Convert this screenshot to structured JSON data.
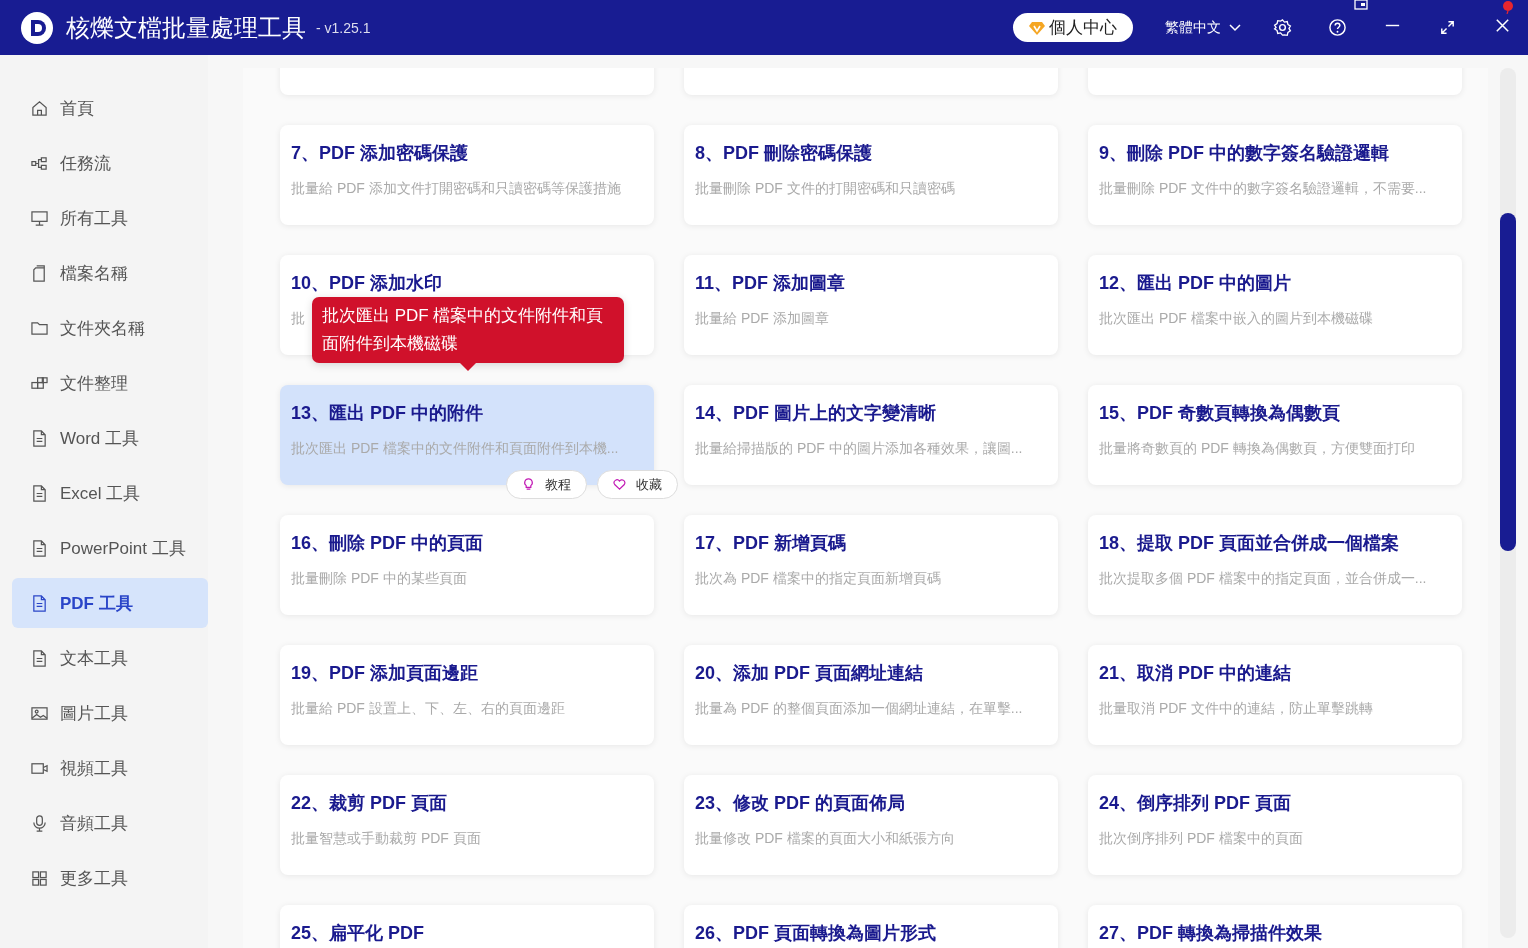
{
  "app": {
    "title": "核爍文檔批量處理工具",
    "version": "- v1.25.1",
    "user_center": "個人中心",
    "language": "繁體中文"
  },
  "sidebar": {
    "items": [
      {
        "label": "首頁",
        "selected": false
      },
      {
        "label": "任務流",
        "selected": false
      },
      {
        "label": "所有工具",
        "selected": false
      },
      {
        "label": "檔案名稱",
        "selected": false
      },
      {
        "label": "文件夾名稱",
        "selected": false
      },
      {
        "label": "文件整理",
        "selected": false
      },
      {
        "label": "Word 工具",
        "selected": false
      },
      {
        "label": "Excel 工具",
        "selected": false
      },
      {
        "label": "PowerPoint 工具",
        "selected": false
      },
      {
        "label": "PDF 工具",
        "selected": true
      },
      {
        "label": "文本工具",
        "selected": false
      },
      {
        "label": "圖片工具",
        "selected": false
      },
      {
        "label": "視頻工具",
        "selected": false
      },
      {
        "label": "音頻工具",
        "selected": false
      },
      {
        "label": "更多工具",
        "selected": false
      }
    ]
  },
  "cards": [
    {
      "title": "7、PDF 添加密碼保護",
      "description": "批量給 PDF 添加文件打開密碼和只讀密碼等保護措施",
      "hovered": false
    },
    {
      "title": "8、PDF 刪除密碼保護",
      "description": "批量刪除 PDF 文件的打開密碼和只讀密碼",
      "hovered": false
    },
    {
      "title": "9、刪除 PDF 中的數字簽名驗證邏輯",
      "description": "批量刪除 PDF 文件中的數字簽名驗證邏輯，不需要...",
      "hovered": false
    },
    {
      "title": "10、PDF 添加水印",
      "description": "批",
      "hovered": false
    },
    {
      "title": "11、PDF 添加圖章",
      "description": "批量給 PDF 添加圖章",
      "hovered": false
    },
    {
      "title": "12、匯出 PDF 中的圖片",
      "description": "批次匯出 PDF 檔案中嵌入的圖片到本機磁碟",
      "hovered": false
    },
    {
      "title": "13、匯出 PDF 中的附件",
      "description": "批次匯出 PDF 檔案中的文件附件和頁面附件到本機...",
      "hovered": true
    },
    {
      "title": "14、PDF 圖片上的文字變清晰",
      "description": "批量給掃描版的 PDF 中的圖片添加各種效果，讓圖...",
      "hovered": false
    },
    {
      "title": "15、PDF 奇數頁轉換為偶數頁",
      "description": "批量將奇數頁的 PDF 轉換為偶數頁，方便雙面打印",
      "hovered": false
    },
    {
      "title": "16、刪除 PDF 中的頁面",
      "description": "批量刪除 PDF 中的某些頁面",
      "hovered": false
    },
    {
      "title": "17、PDF 新增頁碼",
      "description": "批次為 PDF 檔案中的指定頁面新增頁碼",
      "hovered": false
    },
    {
      "title": "18、提取 PDF 頁面並合併成一個檔案",
      "description": "批次提取多個 PDF 檔案中的指定頁面，並合併成一...",
      "hovered": false
    },
    {
      "title": "19、PDF 添加頁面邊距",
      "description": "批量給 PDF 設置上、下、左、右的頁面邊距",
      "hovered": false
    },
    {
      "title": "20、添加 PDF 頁面網址連結",
      "description": "批量為 PDF 的整個頁面添加一個網址連結，在單擊...",
      "hovered": false
    },
    {
      "title": "21、取消 PDF 中的連結",
      "description": "批量取消 PDF 文件中的連結，防止單擊跳轉",
      "hovered": false
    },
    {
      "title": "22、裁剪 PDF 頁面",
      "description": "批量智慧或手動裁剪 PDF 頁面",
      "hovered": false
    },
    {
      "title": "23、修改 PDF 的頁面佈局",
      "description": "批量修改 PDF 檔案的頁面大小和紙張方向",
      "hovered": false
    },
    {
      "title": "24、倒序排列 PDF 頁面",
      "description": "批次倒序排列 PDF 檔案中的頁面",
      "hovered": false
    },
    {
      "title": "25、扁平化 PDF",
      "hovered": false
    },
    {
      "title": "26、PDF 頁面轉換為圖片形式",
      "hovered": false
    },
    {
      "title": "27、PDF 轉換為掃描件效果",
      "hovered": false
    }
  ],
  "tooltip": "批次匯出 PDF 檔案中的文件附件和頁面附件到本機磁碟",
  "card_actions": {
    "tutorial": "教程",
    "favorite": "收藏"
  }
}
